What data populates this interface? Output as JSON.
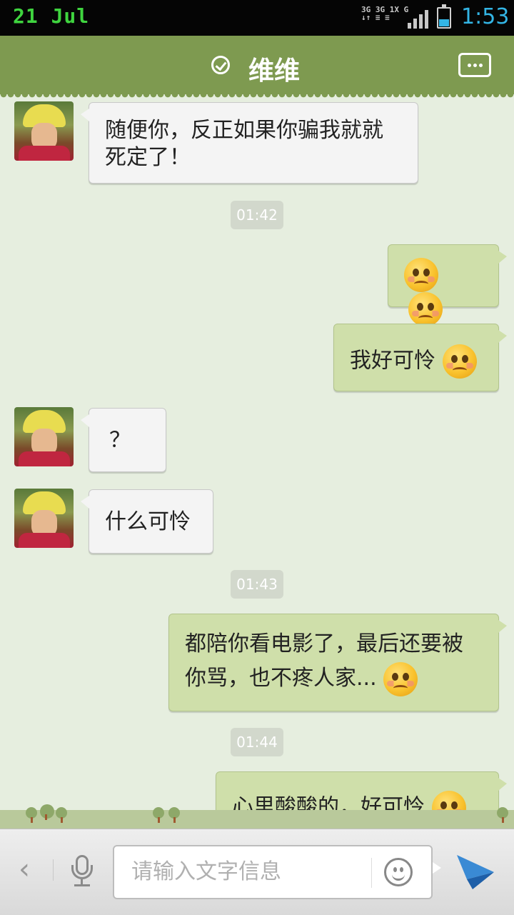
{
  "status_bar": {
    "date": "21 Jul",
    "network_label": "3G 3G 1X G",
    "time": "1:53",
    "battery_level": 0.38,
    "accent_color": "#33b5e5"
  },
  "header": {
    "title": "维维",
    "verified_icon": "check-circle-icon",
    "more_icon": "more-dots-icon",
    "background_color": "#7e9a50"
  },
  "messages": [
    {
      "side": "in",
      "text": "随便你，反正如果你骗我就就死定了！"
    },
    {
      "type": "time",
      "text": "01:42"
    },
    {
      "side": "out",
      "text": "",
      "emoji": [
        "worried-face-emoji",
        "worried-face-emoji"
      ]
    },
    {
      "side": "out",
      "text": "我好可怜",
      "emoji": [
        "shy-face-emoji"
      ]
    },
    {
      "side": "in",
      "text": "？"
    },
    {
      "side": "in",
      "text": "什么可怜"
    },
    {
      "type": "time",
      "text": "01:43"
    },
    {
      "side": "out",
      "text": "都陪你看电影了，最后还要被你骂，也不疼人家...",
      "emoji": [
        "shy-face-emoji"
      ]
    },
    {
      "type": "time",
      "text": "01:44"
    },
    {
      "side": "out",
      "text": "心里酸酸的，好可怜",
      "emoji": [
        "pitiful-face-emoji"
      ]
    }
  ],
  "composer": {
    "placeholder": "请输入文字信息",
    "back_icon": "chevron-left-icon",
    "mic_icon": "microphone-icon",
    "emoji_icon": "smiley-icon",
    "send_icon": "send-arrow-icon"
  }
}
